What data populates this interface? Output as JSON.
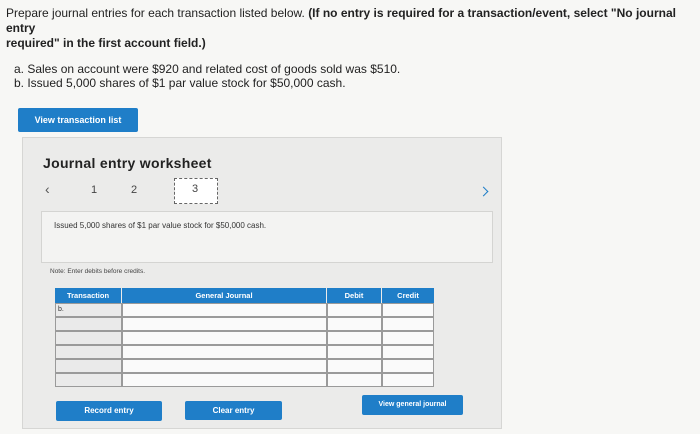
{
  "instructions": {
    "line1_plain": "Prepare journal entries for each transaction listed below.",
    "line1_bold": "(If no entry is required for a transaction/event, select \"No journal entry",
    "line2_bold": "required\" in the first account field.)"
  },
  "transactions": [
    "a. Sales on account were $920 and related cost of goods sold was $510.",
    "b. Issued 5,000 shares of $1 par value stock for $50,000 cash."
  ],
  "view_transaction_list_label": "View transaction list",
  "worksheet": {
    "title": "Journal entry worksheet",
    "pager": {
      "prev_icon": "chevron-left-icon",
      "next_icon": "chevron-right-icon",
      "pages": [
        "1",
        "2",
        "3"
      ],
      "current": "3"
    },
    "description": "Issued 5,000 shares of $1 par value stock for $50,000 cash.",
    "note": "Note: Enter debits before credits.",
    "table": {
      "headers": {
        "transaction": "Transaction",
        "account": "General Journal",
        "debit": "Debit",
        "credit": "Credit"
      },
      "rows": [
        {
          "transaction": "b.",
          "account": "",
          "debit": "",
          "credit": ""
        },
        {
          "transaction": "",
          "account": "",
          "debit": "",
          "credit": ""
        },
        {
          "transaction": "",
          "account": "",
          "debit": "",
          "credit": ""
        },
        {
          "transaction": "",
          "account": "",
          "debit": "",
          "credit": ""
        },
        {
          "transaction": "",
          "account": "",
          "debit": "",
          "credit": ""
        },
        {
          "transaction": "",
          "account": "",
          "debit": "",
          "credit": ""
        }
      ]
    },
    "record_entry_label": "Record entry",
    "clear_entry_label": "Clear entry",
    "view_general_journal_label": "View general journal"
  },
  "colors": {
    "accent": "#1f7ec8",
    "background": "#f7f7f5",
    "worksheet_bg": "#ebebea"
  }
}
